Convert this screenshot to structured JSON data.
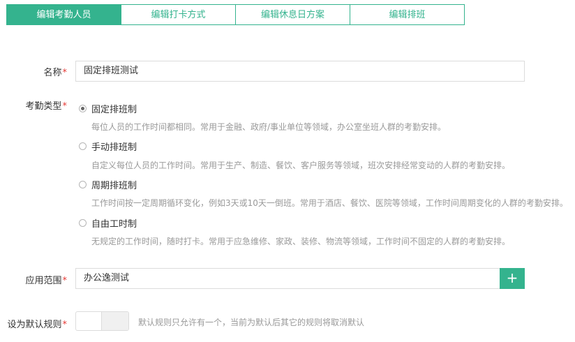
{
  "tabs": [
    {
      "label": "编辑考勤人员",
      "active": true
    },
    {
      "label": "编辑打卡方式",
      "active": false
    },
    {
      "label": "编辑休息日方案",
      "active": false
    },
    {
      "label": "编辑排班",
      "active": false
    }
  ],
  "form": {
    "name": {
      "label": "名称",
      "required_mark": "*",
      "value": "固定排班测试"
    },
    "type": {
      "label": "考勤类型",
      "required_mark": "*",
      "options": [
        {
          "label": "固定排班制",
          "checked": true,
          "desc": "每位人员的工作时间都相同。常用于金融、政府/事业单位等领域，办公室坐班人群的考勤安排。"
        },
        {
          "label": "手动排班制",
          "checked": false,
          "desc": "自定义每位人员的工作时间。常用于生产、制造、餐饮、客户服务等领域，班次安排经常变动的人群的考勤安排。"
        },
        {
          "label": "周期排班制",
          "checked": false,
          "desc": "工作时间按一定周期循环变化，例如3天或10天一倒班。常用于酒店、餐饮、医院等领域，工作时间周期变化的人群的考勤安排。"
        },
        {
          "label": "自由工时制",
          "checked": false,
          "desc": "无规定的工作时间，随时打卡。常用于应急维修、家政、装修、物流等领域，工作时间不固定的人群的考勤安排。"
        }
      ]
    },
    "scope": {
      "label": "应用范围",
      "required_mark": "*",
      "value": "办公逸测试",
      "add_symbol": "+"
    },
    "default_rule": {
      "label": "设为默认规则",
      "required_mark": "*",
      "enabled": false,
      "hint": "默认规则只允许有一个，当前为默认后其它的规则将取消默认"
    }
  },
  "colors": {
    "accent": "#34b38e",
    "required": "#e53935"
  }
}
